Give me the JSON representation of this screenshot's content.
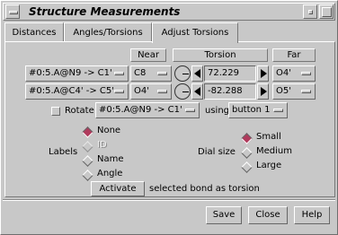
{
  "window": {
    "title": "Structure Measurements"
  },
  "tabs": [
    {
      "label": "Distances"
    },
    {
      "label": "Angles/Torsions"
    },
    {
      "label": "Adjust Torsions"
    }
  ],
  "columns": {
    "near": "Near",
    "torsion": "Torsion",
    "far": "Far"
  },
  "rows": [
    {
      "bond": "#0:5.A@N9 -> C1'",
      "near": "C8",
      "torsion": "72.229",
      "far": "O4'"
    },
    {
      "bond": "#0:5.A@C4' -> C5'",
      "near": "O4'",
      "torsion": "-82.288",
      "far": "O5'"
    }
  ],
  "rotate": {
    "label": "Rotate",
    "bond": "#0:5.A@N9 -> C1'",
    "using": "using",
    "button": "button 1"
  },
  "labels": {
    "title": "Labels",
    "options": [
      "None",
      "ID",
      "Name",
      "Angle"
    ],
    "selected": "None"
  },
  "dial_size": {
    "title": "Dial size",
    "options": [
      "Small",
      "Medium",
      "Large"
    ],
    "selected": "Small"
  },
  "activate": {
    "button": "Activate",
    "text": "selected bond as torsion"
  },
  "footer": {
    "save": "Save",
    "close": "Close",
    "help": "Help"
  },
  "colors": {
    "background": "#c8c8c8",
    "radio_selected": "#b03a5c"
  }
}
